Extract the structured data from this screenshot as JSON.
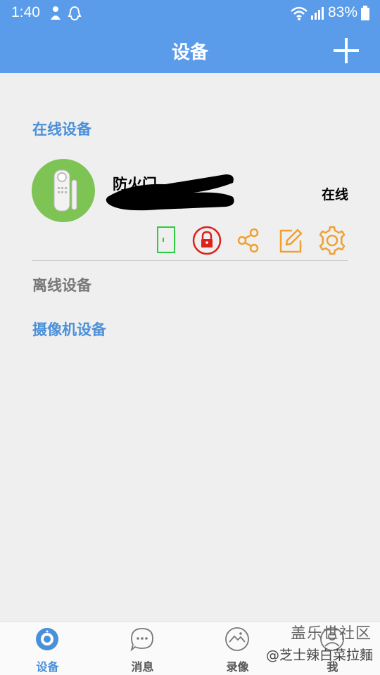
{
  "status_bar": {
    "time": "1:40",
    "battery": "83%"
  },
  "app_bar": {
    "title": "设备",
    "add_icon": "plus-icon"
  },
  "sections": {
    "online": "在线设备",
    "offline": "离线设备",
    "camera": "摄像机设备"
  },
  "device": {
    "name": "防火门",
    "status": "在线",
    "actions": [
      "door-sensor-icon",
      "lock-icon",
      "share-icon",
      "edit-icon",
      "settings-icon"
    ]
  },
  "tabs": [
    {
      "label": "设备",
      "icon": "camera-icon",
      "active": true
    },
    {
      "label": "消息",
      "icon": "message-icon",
      "active": false
    },
    {
      "label": "录像",
      "icon": "gallery-icon",
      "active": false
    },
    {
      "label": "我",
      "icon": "user-icon",
      "active": false
    }
  ],
  "watermark": {
    "top": "盖乐世社区",
    "bottom": "@芝士辣白菜拉麵"
  },
  "colors": {
    "primary": "#5a9ce9",
    "section_blue": "#4a90d9",
    "avatar_green": "#7dc454",
    "lock_red": "#d9231c",
    "door_green": "#2ecc40",
    "action_orange": "#f0a030"
  }
}
